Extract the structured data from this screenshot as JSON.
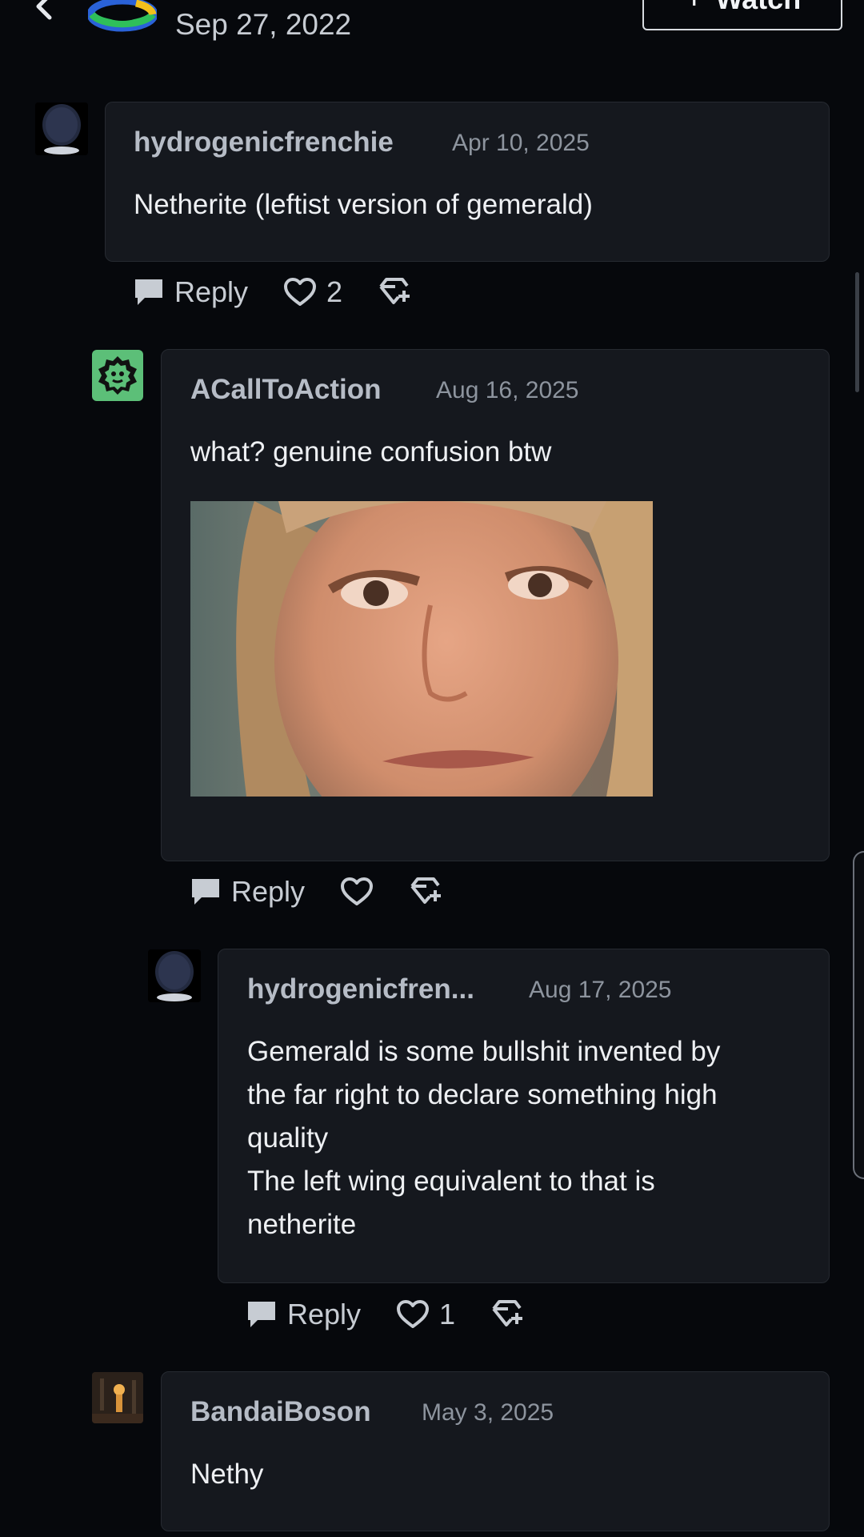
{
  "header": {
    "post_date": "Sep 27, 2022",
    "watch_label": "Watch"
  },
  "comments": [
    {
      "user": "hydrogenicfrenchie",
      "date": "Apr 10, 2025",
      "body": "Netherite (leftist version of gemerald)",
      "reply_label": "Reply",
      "likes": "2"
    },
    {
      "user": "ACallToAction",
      "date": "Aug 16, 2025",
      "body": "what? genuine confusion btw",
      "reply_label": "Reply",
      "likes": ""
    },
    {
      "user": "hydrogenicfren...",
      "date": "Aug 17, 2025",
      "body_lines": [
        "Gemerald is some bullshit invented by",
        "the far right to declare something high",
        "quality",
        "The left wing equivalent to that is",
        "netherite"
      ],
      "reply_label": "Reply",
      "likes": "1"
    },
    {
      "user": "BandaiBoson",
      "date": "May 3, 2025",
      "body": "Nethy"
    }
  ],
  "colors": {
    "background": "#06080c",
    "card": "#15181e",
    "username": "#b6bcc6",
    "avatar_green": "#5cbf78"
  }
}
